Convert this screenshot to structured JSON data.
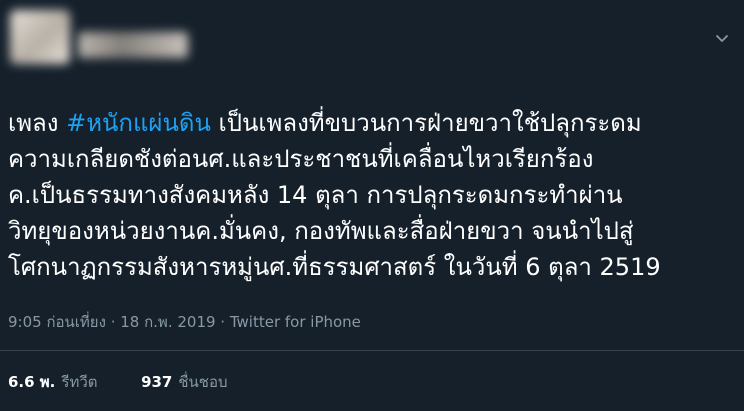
{
  "tweet": {
    "text_lines": [
      "เพลง ",
      "#หนักแผ่นดิน",
      " เป็นเพลงที่ขบวนการฝ่ายขวาใช้ปลุกระดม",
      "ความเกลียดชังต่อนศ.และประชาชนที่เคลื่อนไหวเรียกร้อง",
      "ค.เป็นธรรมทางสังคมหลัง 14 ตุลา การปลุกระดมกระทำผ่าน",
      "วิทยุของหน่วยงานค.มั่นคง, กองทัพและสื่อฝ่ายขวา จนนำไปสู่",
      "โศกนาฏกรรมสังหารหมู่นศ.ที่ธรรมศาสตร์ ในวันที่ 6 ตุลา 2519"
    ],
    "meta": "9:05 ก่อนเที่ยง · 18 ก.พ. 2019 · Twitter for iPhone",
    "retweets_count": "6.6 พ.",
    "retweets_label": "รีทวีต",
    "likes_count": "937",
    "likes_label": "ชื่นชอบ"
  },
  "colors": {
    "background": "#15202b",
    "text": "#ffffff",
    "hashtag": "#1da1f2",
    "muted": "#8899a6"
  },
  "icons": {
    "menu": "chevron-down-icon"
  }
}
